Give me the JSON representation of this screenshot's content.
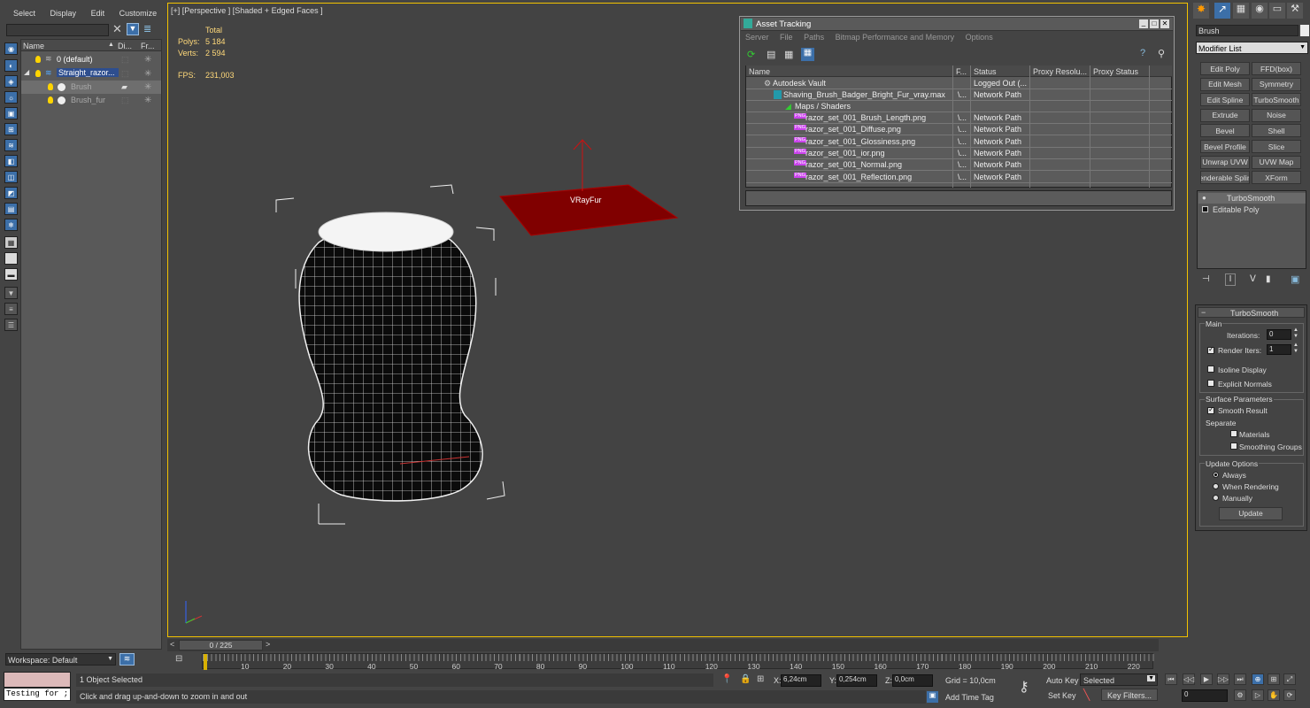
{
  "menu": {
    "select": "Select",
    "display": "Display",
    "edit": "Edit",
    "customize": "Customize"
  },
  "scene_explorer": {
    "headers": {
      "name": "Name",
      "display": "Di...",
      "freeze": "Fr..."
    },
    "rows": [
      {
        "label": "0 (default)"
      },
      {
        "label": "Straight_razor..."
      },
      {
        "label": "Brush"
      },
      {
        "label": "Brush_fur"
      }
    ],
    "workspace": "Workspace: Default"
  },
  "viewport": {
    "label": "[+] [Perspective ] [Shaded + Edged Faces ]",
    "stats": {
      "total": "Total",
      "polys_label": "Polys:",
      "polys": "5 184",
      "verts_label": "Verts:",
      "verts": "2 594",
      "fps_label": "FPS:",
      "fps": "231,003"
    },
    "vrayfur_label": "VRayFur"
  },
  "asset_tracking": {
    "title": "Asset Tracking",
    "menu": [
      "Server",
      "File",
      "Paths",
      "Bitmap Performance and Memory",
      "Options"
    ],
    "headers": [
      "Name",
      "F...",
      "Status",
      "Proxy Resolu...",
      "Proxy Status"
    ],
    "rows": [
      {
        "name": "Autodesk Vault",
        "f": "",
        "status": "Logged Out (..."
      },
      {
        "name": "Shaving_Brush_Badger_Bright_Fur_vray.max",
        "f": "\\...",
        "status": "Network Path"
      },
      {
        "name": "Maps / Shaders",
        "f": "",
        "status": ""
      },
      {
        "name": "razor_set_001_Brush_Length.png",
        "f": "\\...",
        "status": "Network Path"
      },
      {
        "name": "razor_set_001_Diffuse.png",
        "f": "\\...",
        "status": "Network Path"
      },
      {
        "name": "razor_set_001_Glossiness.png",
        "f": "\\...",
        "status": "Network Path"
      },
      {
        "name": "razor_set_001_ior.png",
        "f": "\\...",
        "status": "Network Path"
      },
      {
        "name": "razor_set_001_Normal.png",
        "f": "\\...",
        "status": "Network Path"
      },
      {
        "name": "razor_set_001_Reflection.png",
        "f": "\\...",
        "status": "Network Path"
      }
    ],
    "png_tag": "PNG"
  },
  "command_panel": {
    "object_name": "Brush",
    "modifier_list": "Modifier List",
    "buttons": [
      "Edit Poly",
      "FFD(box)",
      "Edit Mesh",
      "Symmetry",
      "Edit Spline",
      "TurboSmooth",
      "Extrude",
      "Noise",
      "Bevel",
      "Shell",
      "Bevel Profile",
      "Slice",
      "Unwrap UVW",
      "UVW Map",
      "enderable Splin",
      "XForm"
    ],
    "stack": [
      "TurboSmooth",
      "Editable Poly"
    ],
    "rollout": {
      "title": "TurboSmooth",
      "main": "Main",
      "iterations_label": "Iterations:",
      "iterations": "0",
      "render_iters_label": "Render Iters:",
      "render_iters": "1",
      "render_iters_checked": true,
      "isoline": "Isoline Display",
      "explicit": "Explicit Normals",
      "surface": "Surface Parameters",
      "smooth_result": "Smooth Result",
      "smooth_checked": true,
      "separate": "Separate",
      "materials": "Materials",
      "smoothing_groups": "Smoothing Groups",
      "update_options": "Update Options",
      "always": "Always",
      "when_rendering": "When Rendering",
      "manually": "Manually",
      "update_btn": "Update"
    }
  },
  "timeline": {
    "frame": "0 / 225",
    "ticks": [
      "10",
      "20",
      "30",
      "40",
      "50",
      "60",
      "70",
      "80",
      "90",
      "100",
      "110",
      "120",
      "130",
      "140",
      "150",
      "160",
      "170",
      "180",
      "190",
      "200",
      "210",
      "220"
    ]
  },
  "status": {
    "script": "Testing for ;",
    "selected": "1 Object Selected",
    "prompt": "Click and drag up-and-down to zoom in and out",
    "x_label": "X:",
    "x": "6,24cm",
    "y_label": "Y:",
    "y": "0,254cm",
    "z_label": "Z:",
    "z": "0,0cm",
    "grid": "Grid = 10,0cm",
    "add_time_tag": "Add Time Tag",
    "auto_key": "Auto Key",
    "set_key": "Set Key",
    "selected_dd": "Selected",
    "key_filters": "Key Filters...",
    "frame_field": "0"
  }
}
